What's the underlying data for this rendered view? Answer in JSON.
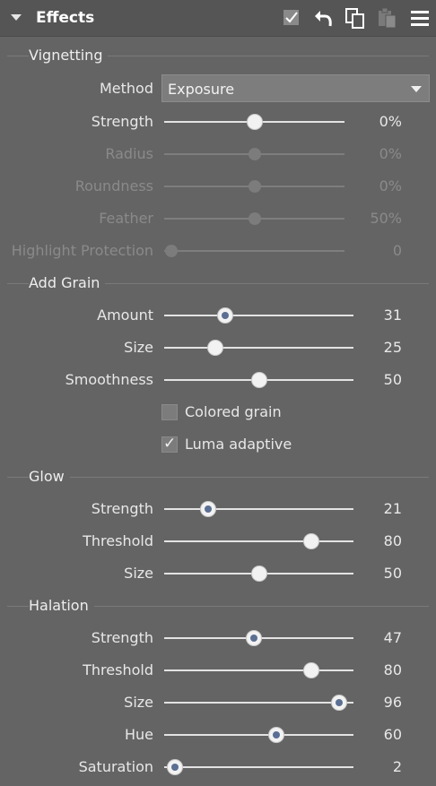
{
  "panel": {
    "title": "Effects",
    "icons": [
      "checkbox-icon",
      "undo-icon",
      "copy-icon",
      "paste-icon",
      "menu-icon"
    ]
  },
  "vignetting": {
    "title": "Vignetting",
    "method_label": "Method",
    "method_value": "Exposure",
    "rows": [
      {
        "label": "Strength",
        "value": "0%",
        "fraction": 0.5,
        "enabled": true
      },
      {
        "label": "Radius",
        "value": "0%",
        "fraction": 0.5,
        "enabled": false
      },
      {
        "label": "Roundness",
        "value": "0%",
        "fraction": 0.5,
        "enabled": false
      },
      {
        "label": "Feather",
        "value": "50%",
        "fraction": 0.5,
        "enabled": false
      },
      {
        "label": "Highlight Protection",
        "value": "0",
        "fraction": 0.0,
        "enabled": false
      }
    ]
  },
  "grain": {
    "title": "Add Grain",
    "rows": [
      {
        "label": "Amount",
        "value": "31",
        "fraction": 0.31
      },
      {
        "label": "Size",
        "value": "25",
        "fraction": 0.25
      },
      {
        "label": "Smoothness",
        "value": "50",
        "fraction": 0.5
      }
    ],
    "colored_grain": {
      "label": "Colored grain",
      "checked": false
    },
    "luma_adaptive": {
      "label": "Luma adaptive",
      "checked": true,
      "mark": "✓"
    }
  },
  "glow": {
    "title": "Glow",
    "rows": [
      {
        "label": "Strength",
        "value": "21",
        "fraction": 0.21
      },
      {
        "label": "Threshold",
        "value": "80",
        "fraction": 0.8
      },
      {
        "label": "Size",
        "value": "50",
        "fraction": 0.5
      }
    ]
  },
  "halation": {
    "title": "Halation",
    "rows": [
      {
        "label": "Strength",
        "value": "47",
        "fraction": 0.47
      },
      {
        "label": "Threshold",
        "value": "80",
        "fraction": 0.8
      },
      {
        "label": "Size",
        "value": "96",
        "fraction": 0.96
      },
      {
        "label": "Hue",
        "value": "60",
        "fraction": 0.6
      },
      {
        "label": "Saturation",
        "value": "2",
        "fraction": 0.02
      }
    ]
  }
}
